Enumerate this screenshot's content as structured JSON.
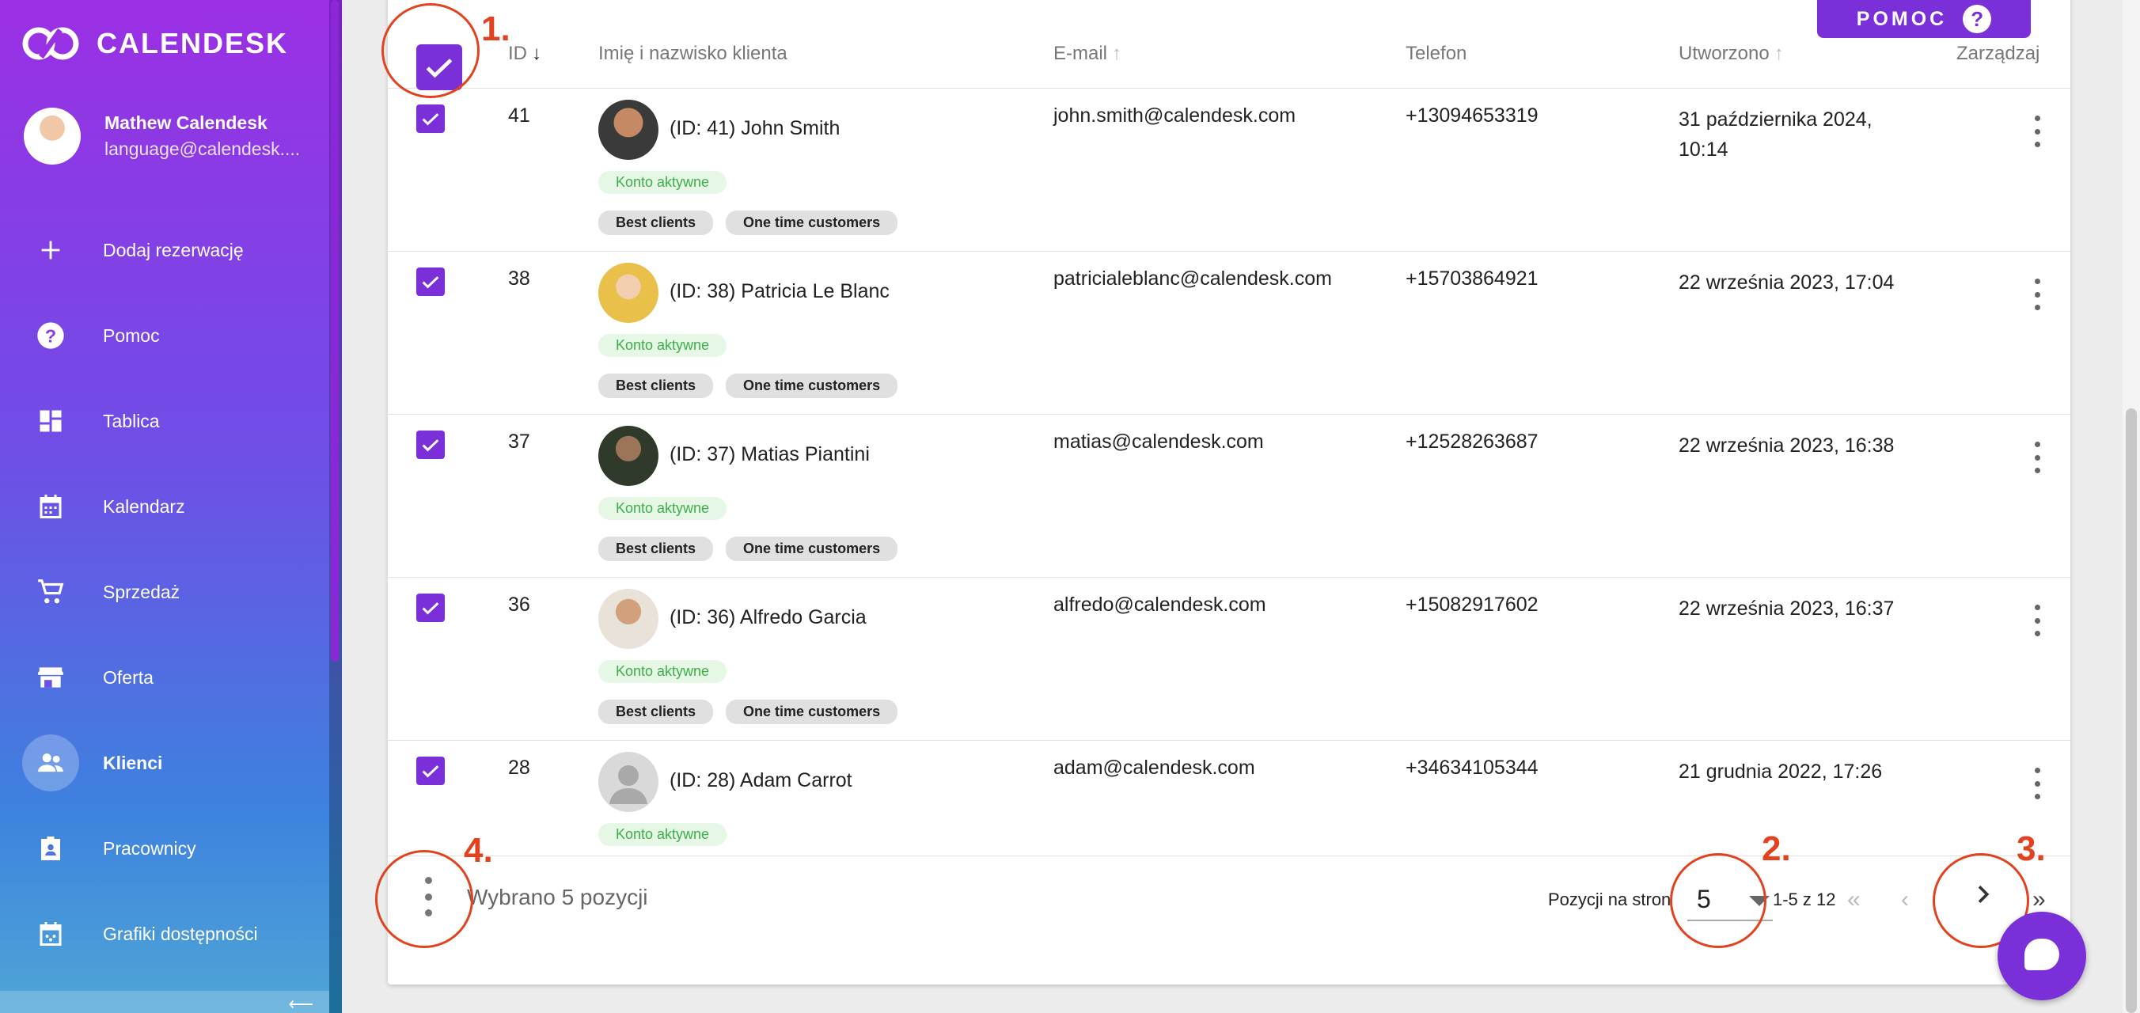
{
  "app": {
    "name": "CALENDESK"
  },
  "user": {
    "name": "Mathew Calendesk",
    "email": "language@calendesk...."
  },
  "sidebar": {
    "items": [
      {
        "label": "Dodaj rezerwację",
        "icon": "plus-icon"
      },
      {
        "label": "Pomoc",
        "icon": "help-circle-icon"
      },
      {
        "label": "Tablica",
        "icon": "dashboard-icon"
      },
      {
        "label": "Kalendarz",
        "icon": "calendar-icon"
      },
      {
        "label": "Sprzedaż",
        "icon": "cart-icon"
      },
      {
        "label": "Oferta",
        "icon": "store-icon"
      },
      {
        "label": "Klienci",
        "icon": "users-icon",
        "active": true
      },
      {
        "label": "Pracownicy",
        "icon": "badge-icon"
      },
      {
        "label": "Grafiki dostępności",
        "icon": "schedule-icon"
      }
    ]
  },
  "help_button": {
    "label": "POMOC",
    "icon": "?"
  },
  "table": {
    "headers": {
      "id": "ID",
      "name": "Imię i nazwisko klienta",
      "email": "E-mail",
      "phone": "Telefon",
      "created": "Utworzono",
      "manage": "Zarządzaj"
    },
    "rows": [
      {
        "id": "41",
        "name": "(ID: 41) John Smith",
        "status": "Konto aktywne",
        "tags": [
          "Best clients",
          "One time customers"
        ],
        "email": "john.smith@calendesk.com",
        "phone": "+13094653319",
        "created": "31 października 2024, 10:14"
      },
      {
        "id": "38",
        "name": "(ID: 38) Patricia Le Blanc",
        "status": "Konto aktywne",
        "tags": [
          "Best clients",
          "One time customers"
        ],
        "email": "patricialeblanc@calendesk.com",
        "phone": "+15703864921",
        "created": "22 września 2023, 17:04"
      },
      {
        "id": "37",
        "name": "(ID: 37) Matias Piantini",
        "status": "Konto aktywne",
        "tags": [
          "Best clients",
          "One time customers"
        ],
        "email": "matias@calendesk.com",
        "phone": "+12528263687",
        "created": "22 września 2023, 16:38"
      },
      {
        "id": "36",
        "name": "(ID: 36) Alfredo Garcia",
        "status": "Konto aktywne",
        "tags": [
          "Best clients",
          "One time customers"
        ],
        "email": "alfredo@calendesk.com",
        "phone": "+15082917602",
        "created": "22 września 2023, 16:37"
      },
      {
        "id": "28",
        "name": "(ID: 28) Adam Carrot",
        "status": "Konto aktywne",
        "tags": [],
        "email": "adam@calendesk.com",
        "phone": "+34634105344",
        "created": "21 grudnia 2022, 17:26"
      }
    ]
  },
  "footer": {
    "selected_text": "Wybrano 5 pozycji",
    "per_page_label": "Pozycji na stron",
    "per_page_value": "5",
    "range": "1-5 z 12"
  },
  "annotations": {
    "a1": "1.",
    "a2": "2.",
    "a3": "3.",
    "a4": "4."
  },
  "colors": {
    "accent": "#7a2fd8",
    "annotation": "#e2421f",
    "status_bg": "#e6f7e6",
    "status_fg": "#3dae4a"
  }
}
